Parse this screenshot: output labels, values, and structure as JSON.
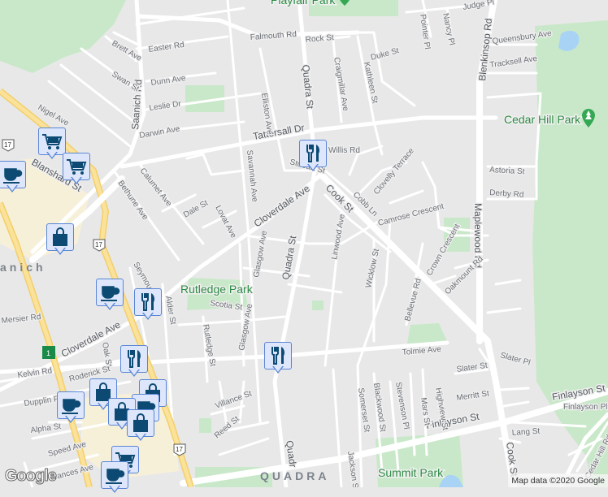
{
  "map": {
    "parks": [
      "Playfair Park",
      "Cedar Hill Park",
      "Rutledge Park",
      "Summit Park"
    ],
    "area_label": "QUADRA",
    "area_label_partial": "anich",
    "streets": [
      "Quadra St",
      "Tattersall Dr",
      "Cloverdale Ave",
      "Cook St",
      "Blenkinsop Rd",
      "Maplewood Rd",
      "Finlayson St",
      "Tolmie Ave",
      "Saanich Rd",
      "Blanshard St",
      "Falmouth Rd",
      "Rock St",
      "Easter Rd",
      "Brett Ave",
      "Swan St",
      "Dunn Ave",
      "Leslie Dr",
      "Darwin Ave",
      "Nigel Ave",
      "Savannah Ave",
      "Elliston Ave",
      "Calumet Ave",
      "Bethune Ave",
      "Dale St",
      "Lovat Ave",
      "Glasgow Ave",
      "Scotia St",
      "Alder St",
      "Rutledge St",
      "Seymour Pl",
      "Oak St",
      "Kelvin Rd",
      "Roderick St",
      "Dupplin Rd",
      "Alpha St",
      "Speed Ave",
      "Frances Ave",
      "Villance St",
      "Reed St",
      "Linwood Ave",
      "Wicklow St",
      "Camrose Crescent",
      "Crown Crescent",
      "Oakmount Rd",
      "Bellevue Rd",
      "Cobb Ln",
      "Clovelly Terrace",
      "Astoria St",
      "Derby Rd",
      "Queensbury Ave",
      "Tracksell Ave",
      "Judge Pl",
      "Pointer Pl",
      "Nancy Pl",
      "Duke St",
      "Kathleen St",
      "Craigmillar Ave",
      "Slater St",
      "Slater Pl",
      "Merritt St",
      "Finlayson Pl",
      "Lang St",
      "Somerset St",
      "Blackwood St",
      "Stevenson Pl",
      "Mars St",
      "Highview St",
      "Jackson St",
      "Cedar Hill Rd",
      "Mersier Rd",
      "Willis Rd",
      "Stobart St",
      "Finlayson St",
      "Quadr"
    ],
    "route_shields": [
      "17",
      "17",
      "17",
      "1"
    ],
    "markers": [
      "shopping-cart",
      "shopping-cart",
      "coffee-cup",
      "shopping-bag",
      "coffee-cup",
      "restaurant",
      "restaurant",
      "restaurant",
      "shopping-bag",
      "shopping-bag",
      "shopping-bag",
      "shopping-bag",
      "coffee-cup",
      "coffee-cup",
      "shopping-cart",
      "restaurant",
      "shopping-bag"
    ],
    "attribution": "Map data ©2020 Google",
    "logo": "Google",
    "colors": {
      "park": "#c9e8c9",
      "road": "#ffffff",
      "highway": "#f3cf6b",
      "marker_fill": "#dde6fa",
      "marker_icon": "#0d4a73",
      "park_label": "#2e8b45"
    }
  }
}
